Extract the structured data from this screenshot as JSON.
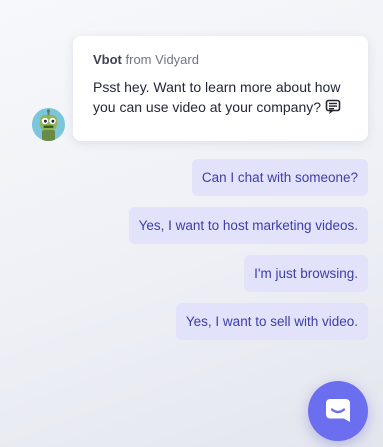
{
  "message": {
    "sender_name": "Vbot",
    "sender_suffix": " from Vidyard",
    "text": "Psst hey. Want to learn more about how you can use video at your company?",
    "avatar_icon": "robot-avatar-icon",
    "emoji_icon": "chat-emoji-icon"
  },
  "quick_replies": [
    "Can I chat with someone?",
    "Yes, I want to host marketing videos.",
    "I'm just browsing.",
    "Yes, I want to sell with video."
  ],
  "launcher": {
    "icon": "chat-launcher-icon"
  },
  "colors": {
    "accent": "#6c6ef0",
    "chip_background": "#e3e2fb",
    "chip_text": "#3b3fa6"
  }
}
